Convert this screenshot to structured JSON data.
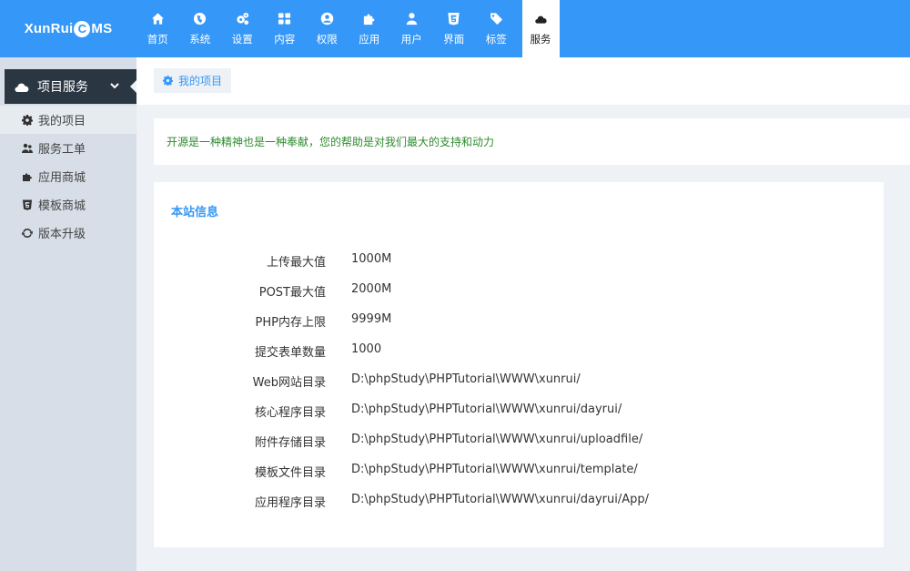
{
  "header": {
    "logo": {
      "part1": "XunRui",
      "part2": "C",
      "part3": "MS"
    },
    "nav": [
      {
        "label": "首页",
        "icon": "home-icon"
      },
      {
        "label": "系统",
        "icon": "globe-icon"
      },
      {
        "label": "设置",
        "icon": "cogs-icon"
      },
      {
        "label": "内容",
        "icon": "grid-icon"
      },
      {
        "label": "权限",
        "icon": "user-circle-icon"
      },
      {
        "label": "应用",
        "icon": "puzzle-icon"
      },
      {
        "label": "用户",
        "icon": "user-icon"
      },
      {
        "label": "界面",
        "icon": "html5-icon"
      },
      {
        "label": "标签",
        "icon": "tags-icon"
      },
      {
        "label": "服务",
        "icon": "cloud-icon",
        "active": true
      }
    ]
  },
  "sidebar": {
    "section_title": "项目服务",
    "items": [
      {
        "label": "我的项目",
        "icon": "cog-icon",
        "active": true
      },
      {
        "label": "服务工单",
        "icon": "users-icon"
      },
      {
        "label": "应用商城",
        "icon": "puzzle-icon"
      },
      {
        "label": "模板商城",
        "icon": "html5-icon"
      },
      {
        "label": "版本升级",
        "icon": "refresh-icon"
      }
    ]
  },
  "breadcrumb": {
    "label": "我的项目"
  },
  "notice": "开源是一种精神也是一种奉献，您的帮助是对我们最大的支持和动力",
  "site_info": {
    "title": "本站信息",
    "rows": [
      {
        "label": "上传最大值",
        "value": "1000M"
      },
      {
        "label": "POST最大值",
        "value": "2000M"
      },
      {
        "label": "PHP内存上限",
        "value": "9999M"
      },
      {
        "label": "提交表单数量",
        "value": "1000"
      },
      {
        "label": "Web网站目录",
        "value": "D:\\phpStudy\\PHPTutorial\\WWW\\xunrui/"
      },
      {
        "label": "核心程序目录",
        "value": "D:\\phpStudy\\PHPTutorial\\WWW\\xunrui/dayrui/"
      },
      {
        "label": "附件存储目录",
        "value": "D:\\phpStudy\\PHPTutorial\\WWW\\xunrui/uploadfile/"
      },
      {
        "label": "模板文件目录",
        "value": "D:\\phpStudy\\PHPTutorial\\WWW\\xunrui/template/"
      },
      {
        "label": "应用程序目录",
        "value": "D:\\phpStudy\\PHPTutorial\\WWW\\xunrui/dayrui/App/"
      }
    ]
  },
  "colors": {
    "header": "#3597f7",
    "sidebar": "#d7dee7",
    "sidebar_head": "#2b3643",
    "notice_text": "#2e8b2e"
  }
}
